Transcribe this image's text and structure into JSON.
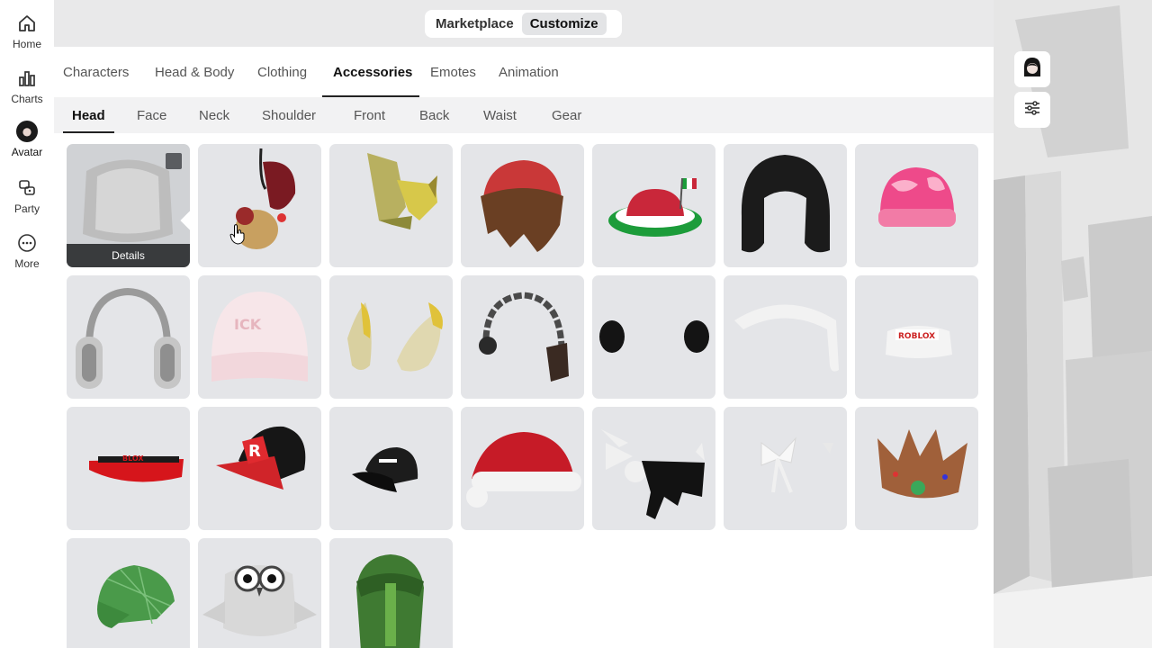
{
  "nav": {
    "items": [
      {
        "label": "Home",
        "icon": "home-icon"
      },
      {
        "label": "Charts",
        "icon": "charts-icon"
      },
      {
        "label": "Avatar",
        "icon": "avatar-icon"
      },
      {
        "label": "Party",
        "icon": "party-icon"
      },
      {
        "label": "More",
        "icon": "more-icon"
      }
    ],
    "active": "Avatar"
  },
  "segment": {
    "options": [
      "Marketplace",
      "Customize"
    ],
    "selected": "Customize"
  },
  "tabs": {
    "items": [
      "Characters",
      "Head & Body",
      "Clothing",
      "Accessories",
      "Emotes",
      "Animation"
    ],
    "active": "Accessories"
  },
  "subtabs": {
    "items": [
      "Head",
      "Face",
      "Neck",
      "Shoulder",
      "Front",
      "Back",
      "Waist",
      "Gear"
    ],
    "active": "Head"
  },
  "grid": {
    "details_label": "Details",
    "items": [
      {
        "name": "hood-item",
        "selected": true
      },
      {
        "name": "red-bow-doll-item"
      },
      {
        "name": "yellow-horn-item"
      },
      {
        "name": "brown-hair-red-beanie-item"
      },
      {
        "name": "mexico-flag-hat-item"
      },
      {
        "name": "black-hair-item"
      },
      {
        "name": "pink-beanie-item"
      },
      {
        "name": "headphones-item"
      },
      {
        "name": "white-knit-beanie-item"
      },
      {
        "name": "yellow-horns-item"
      },
      {
        "name": "chain-headband-item"
      },
      {
        "name": "black-earmuffs-item"
      },
      {
        "name": "white-headband-item"
      },
      {
        "name": "roblox-visor-white-item"
      },
      {
        "name": "red-visor-item"
      },
      {
        "name": "roblox-cap-item"
      },
      {
        "name": "black-cap-item"
      },
      {
        "name": "santa-hat-item"
      },
      {
        "name": "black-wing-item"
      },
      {
        "name": "white-bows-item"
      },
      {
        "name": "gingerbread-crown-item"
      },
      {
        "name": "green-plaid-cap-item"
      },
      {
        "name": "owl-hat-item"
      },
      {
        "name": "green-hood-item"
      }
    ]
  },
  "colors": {
    "accent": "#222222",
    "tile_bg": "#e4e5e8",
    "details_bg": "#393b3d"
  }
}
